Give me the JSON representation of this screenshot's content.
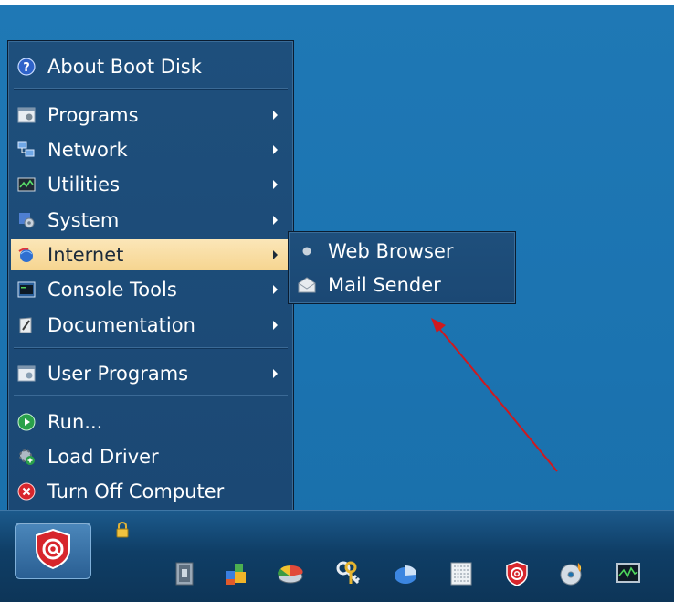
{
  "start_menu": {
    "items": [
      {
        "label": "About Boot Disk",
        "icon": "help-icon",
        "has_submenu": false
      },
      {
        "label": "Programs",
        "icon": "programs-icon",
        "has_submenu": true
      },
      {
        "label": "Network",
        "icon": "network-icon",
        "has_submenu": true
      },
      {
        "label": "Utilities",
        "icon": "utilities-icon",
        "has_submenu": true
      },
      {
        "label": "System",
        "icon": "system-icon",
        "has_submenu": true
      },
      {
        "label": "Internet",
        "icon": "internet-icon",
        "has_submenu": true,
        "highlighted": true
      },
      {
        "label": "Console Tools",
        "icon": "console-icon",
        "has_submenu": true
      },
      {
        "label": "Documentation",
        "icon": "documentation-icon",
        "has_submenu": true
      },
      {
        "label": "User Programs",
        "icon": "user-programs-icon",
        "has_submenu": true
      },
      {
        "label": "Run...",
        "icon": "run-icon",
        "has_submenu": false
      },
      {
        "label": "Load Driver",
        "icon": "load-driver-icon",
        "has_submenu": false
      },
      {
        "label": "Turn Off Computer",
        "icon": "power-icon",
        "has_submenu": false
      }
    ]
  },
  "submenu": {
    "items": [
      {
        "label": "Web Browser",
        "icon": "bullet-icon"
      },
      {
        "label": "Mail Sender",
        "icon": "mail-icon"
      }
    ]
  },
  "taskbar": {
    "start_icon": "at-shield-icon",
    "lock_icon": "lock-icon",
    "tray_icons": [
      "file-manager-icon",
      "windows-apps-icon",
      "disk-partition-icon",
      "keys-icon",
      "pie-chart-icon",
      "hex-editor-icon",
      "at-shield-icon",
      "cd-burn-icon",
      "monitor-icon"
    ]
  },
  "colors": {
    "desktop": "#1b73b0",
    "menu_bg": "#1e4f7c",
    "highlight": "#f8dca0",
    "annotation_arrow": "#d0191e"
  }
}
